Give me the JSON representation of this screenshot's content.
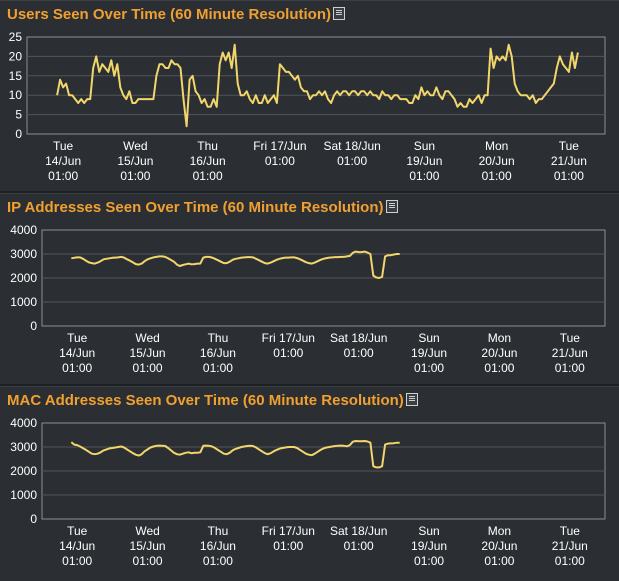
{
  "colors": {
    "line": "#f2d56b",
    "grid": "#50555a",
    "plot_border": "#8a8f94",
    "axis_text": "#ffffff",
    "title": "#f0a030"
  },
  "icon": "document-list-icon",
  "x_ticks": [
    [
      "Tue",
      "14/Jun",
      "01:00"
    ],
    [
      "Wed",
      "15/Jun",
      "01:00"
    ],
    [
      "Thu",
      "16/Jun",
      "01:00"
    ],
    [
      "Fri 17/Jun",
      "01:00"
    ],
    [
      "Sat 18/Jun",
      "01:00"
    ],
    [
      "Sun",
      "19/Jun",
      "01:00"
    ],
    [
      "Mon",
      "20/Jun",
      "01:00"
    ],
    [
      "Tue",
      "21/Jun",
      "01:00"
    ]
  ],
  "chart_data": [
    {
      "type": "line",
      "title": "Users Seen Over Time (60 Minute Resolution)",
      "ylim": [
        0,
        25
      ],
      "yticks": [
        0,
        5,
        10,
        15,
        20,
        25
      ],
      "x_start_index": -2,
      "values": [
        10,
        14,
        12,
        13,
        10,
        10,
        9,
        8,
        9,
        8,
        9,
        9,
        17,
        20,
        16,
        18,
        17,
        16,
        19,
        15,
        18,
        12,
        10,
        9,
        11,
        8,
        8,
        9,
        9,
        9,
        9,
        9,
        9,
        15,
        18,
        18,
        17,
        17,
        19,
        18,
        18,
        17,
        9,
        2,
        14,
        15,
        11,
        10,
        8,
        9,
        7,
        7,
        9,
        7,
        18,
        21,
        19,
        21,
        17,
        23,
        13,
        10,
        10,
        11,
        9,
        8,
        10,
        8,
        8,
        10,
        8,
        9,
        10,
        8,
        18,
        17,
        16,
        16,
        15,
        14,
        15,
        12,
        11,
        11,
        9,
        10,
        10,
        11,
        10,
        11,
        9,
        8,
        10,
        11,
        10,
        11,
        11,
        10,
        11,
        11,
        10,
        11,
        11,
        10,
        11,
        10,
        10,
        9,
        11,
        10,
        10,
        9,
        10,
        10,
        9,
        9,
        9,
        8,
        8,
        10,
        9,
        12,
        10,
        11,
        10,
        10,
        12,
        10,
        9,
        11,
        11,
        10,
        9,
        7,
        8,
        7,
        7,
        9,
        8,
        9,
        10,
        8,
        10,
        10,
        22,
        17,
        20,
        19,
        20,
        19,
        23,
        20,
        13,
        11,
        10,
        10,
        10,
        9,
        10,
        8,
        9,
        9,
        10,
        11,
        12,
        13,
        17,
        20,
        18,
        17,
        16,
        21,
        17,
        21
      ]
    },
    {
      "type": "line",
      "title": "IP Addresses Seen Over Time (60 Minute Resolution)",
      "ylim": [
        0,
        4000
      ],
      "yticks": [
        0,
        1000,
        2000,
        3000,
        4000
      ],
      "x_start_index": -2,
      "values": [
        2820,
        2840,
        2860,
        2860,
        2800,
        2720,
        2650,
        2620,
        2600,
        2640,
        2700,
        2780,
        2800,
        2820,
        2840,
        2850,
        2860,
        2880,
        2850,
        2780,
        2720,
        2650,
        2580,
        2560,
        2600,
        2700,
        2780,
        2820,
        2860,
        2880,
        2900,
        2900,
        2880,
        2820,
        2750,
        2680,
        2560,
        2500,
        2540,
        2570,
        2600,
        2570,
        2580,
        2600,
        2600,
        2850,
        2880,
        2880,
        2850,
        2800,
        2740,
        2680,
        2620,
        2620,
        2680,
        2760,
        2800,
        2820,
        2850,
        2860,
        2870,
        2870,
        2860,
        2800,
        2740,
        2680,
        2620,
        2600,
        2640,
        2700,
        2760,
        2800,
        2830,
        2850,
        2850,
        2860,
        2860,
        2830,
        2780,
        2720,
        2660,
        2620,
        2600,
        2640,
        2700,
        2760,
        2800,
        2830,
        2850,
        2860,
        2870,
        2870,
        2880,
        2880,
        2900,
        2920,
        3050,
        3100,
        3080,
        3080,
        3100,
        3060,
        3000,
        2100,
        2020,
        2000,
        2050,
        2900,
        2950,
        2950,
        2980,
        3000,
        3000
      ]
    },
    {
      "type": "line",
      "title": "MAC Addresses Seen Over Time (60 Minute Resolution)",
      "ylim": [
        0,
        4000
      ],
      "yticks": [
        0,
        1000,
        2000,
        3000,
        4000
      ],
      "x_start_index": -2,
      "values": [
        3200,
        3100,
        3080,
        3020,
        2950,
        2880,
        2800,
        2720,
        2700,
        2720,
        2780,
        2860,
        2900,
        2940,
        2960,
        2980,
        3000,
        3020,
        2980,
        2900,
        2820,
        2740,
        2680,
        2640,
        2700,
        2820,
        2900,
        2980,
        3020,
        3050,
        3060,
        3050,
        3040,
        2960,
        2860,
        2760,
        2700,
        2680,
        2720,
        2760,
        2780,
        2740,
        2760,
        2760,
        2780,
        3050,
        3060,
        3050,
        3020,
        2960,
        2880,
        2800,
        2720,
        2700,
        2760,
        2860,
        2920,
        2960,
        3000,
        3020,
        3040,
        3050,
        3040,
        2980,
        2900,
        2820,
        2740,
        2700,
        2740,
        2820,
        2880,
        2930,
        2960,
        2980,
        3000,
        3000,
        3000,
        2960,
        2880,
        2800,
        2720,
        2680,
        2660,
        2720,
        2800,
        2880,
        2940,
        2980,
        3000,
        3020,
        3040,
        3050,
        3060,
        3050,
        3030,
        3080,
        3220,
        3250,
        3240,
        3240,
        3250,
        3230,
        3180,
        2200,
        2150,
        2150,
        2200,
        3100,
        3140,
        3150,
        3160,
        3180,
        3180
      ]
    }
  ]
}
